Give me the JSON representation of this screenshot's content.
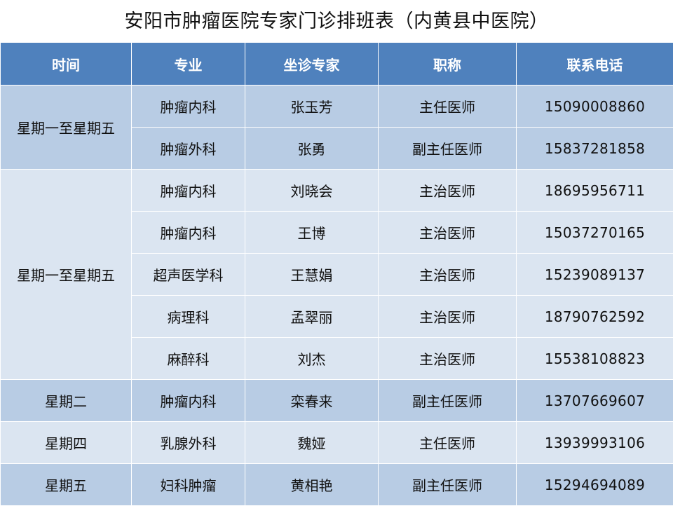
{
  "title": "安阳市肿瘤医院专家门诊排班表（内黄县中医院）",
  "headers": {
    "time": "时间",
    "specialty": "专业",
    "expert": "坐诊专家",
    "rank": "职称",
    "phone": "联系电话"
  },
  "groups": [
    {
      "time": "星期一至星期五",
      "rows": [
        {
          "specialty": "肿瘤内科",
          "expert": "张玉芳",
          "rank": "主任医师",
          "phone": "15090008860"
        },
        {
          "specialty": "肿瘤外科",
          "expert": "张勇",
          "rank": "副主任医师",
          "phone": "15837281858"
        }
      ]
    },
    {
      "time": "星期一至星期五",
      "rows": [
        {
          "specialty": "肿瘤内科",
          "expert": "刘晓会",
          "rank": "主治医师",
          "phone": "18695956711"
        },
        {
          "specialty": "肿瘤内科",
          "expert": "王博",
          "rank": "主治医师",
          "phone": "15037270165"
        },
        {
          "specialty": "超声医学科",
          "expert": "王慧娟",
          "rank": "主治医师",
          "phone": "15239089137"
        },
        {
          "specialty": "病理科",
          "expert": "孟翠丽",
          "rank": "主治医师",
          "phone": "18790762592"
        },
        {
          "specialty": "麻醉科",
          "expert": "刘杰",
          "rank": "主治医师",
          "phone": "15538108823"
        }
      ]
    },
    {
      "time": "星期二",
      "rows": [
        {
          "specialty": "肿瘤内科",
          "expert": "栾春来",
          "rank": "副主任医师",
          "phone": "13707669607"
        }
      ]
    },
    {
      "time": "星期四",
      "rows": [
        {
          "specialty": "乳腺外科",
          "expert": "魏娅",
          "rank": "主任医师",
          "phone": "13939993106"
        }
      ]
    },
    {
      "time": "星期五",
      "rows": [
        {
          "specialty": "妇科肿瘤",
          "expert": "黄相艳",
          "rank": "副主任医师",
          "phone": "15294694089"
        }
      ]
    }
  ],
  "colors": {
    "header_bg": "#4f81bd",
    "band_dark": "#b8cce4",
    "band_light": "#dbe5f1"
  }
}
